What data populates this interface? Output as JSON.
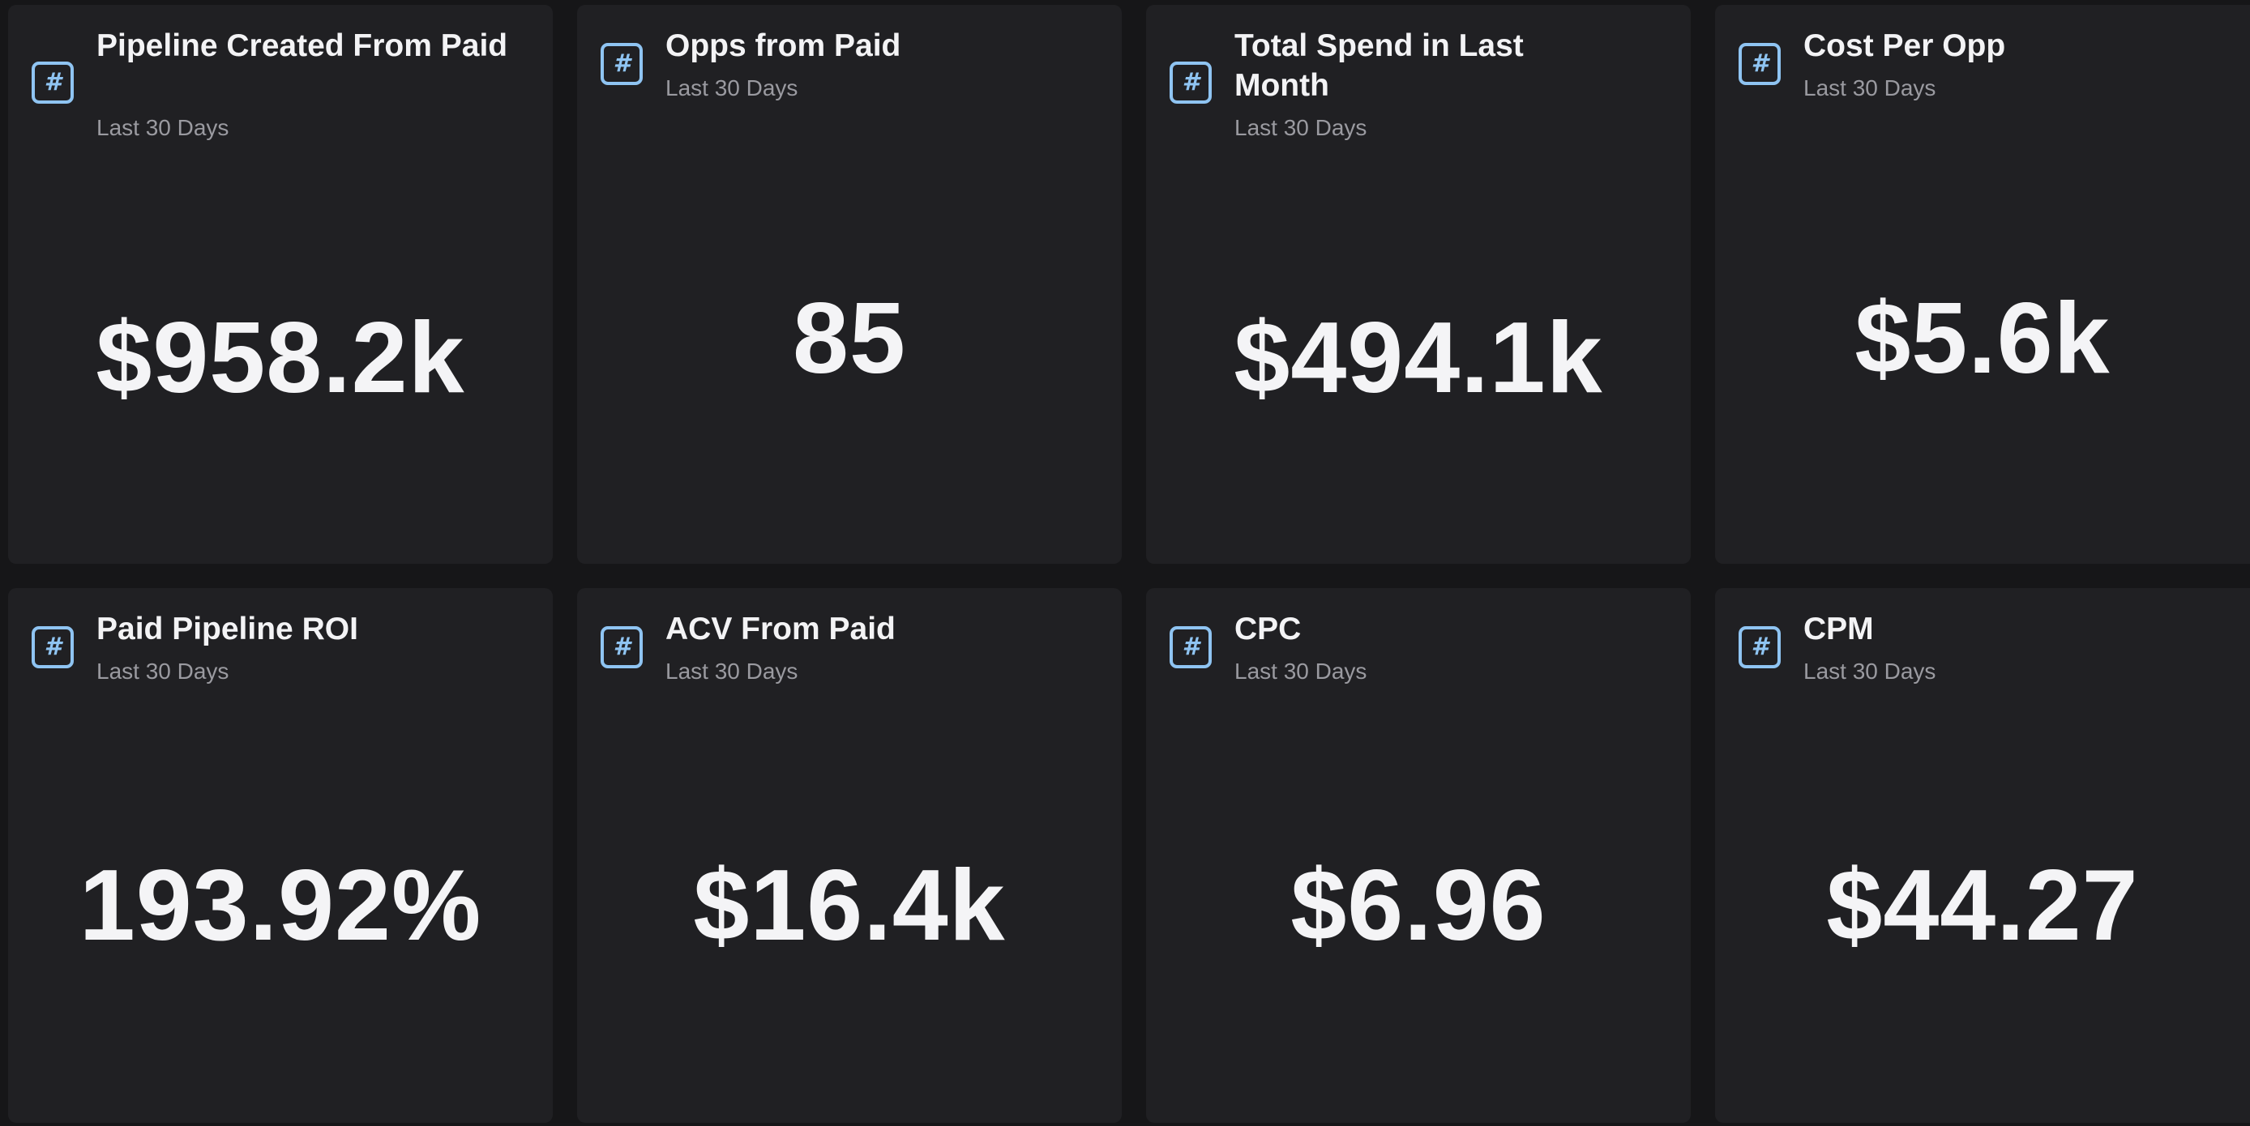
{
  "colors": {
    "background": "#161618",
    "card": "#202023",
    "accent_icon": "#8fc4f2",
    "title_text": "#f3f3f5",
    "subtitle_text": "#9a9aa0",
    "value_text": "#f4f4f6"
  },
  "icon_name": "hash-icon",
  "icon_glyph": "#",
  "cards": [
    {
      "title": "Pipeline Created From Paid",
      "subtitle": "Last 30 Days",
      "value": "$958.2k"
    },
    {
      "title": "Opps from Paid",
      "subtitle": "Last 30 Days",
      "value": "85"
    },
    {
      "title": "Total Spend in Last Month",
      "subtitle": "Last 30 Days",
      "value": "$494.1k"
    },
    {
      "title": "Cost Per Opp",
      "subtitle": "Last 30 Days",
      "value": "$5.6k"
    },
    {
      "title": "Paid Pipeline ROI",
      "subtitle": "Last 30 Days",
      "value": "193.92%"
    },
    {
      "title": "ACV From Paid",
      "subtitle": "Last 30 Days",
      "value": "$16.4k"
    },
    {
      "title": "CPC",
      "subtitle": "Last 30 Days",
      "value": "$6.96"
    },
    {
      "title": "CPM",
      "subtitle": "Last 30 Days",
      "value": "$44.27"
    }
  ]
}
